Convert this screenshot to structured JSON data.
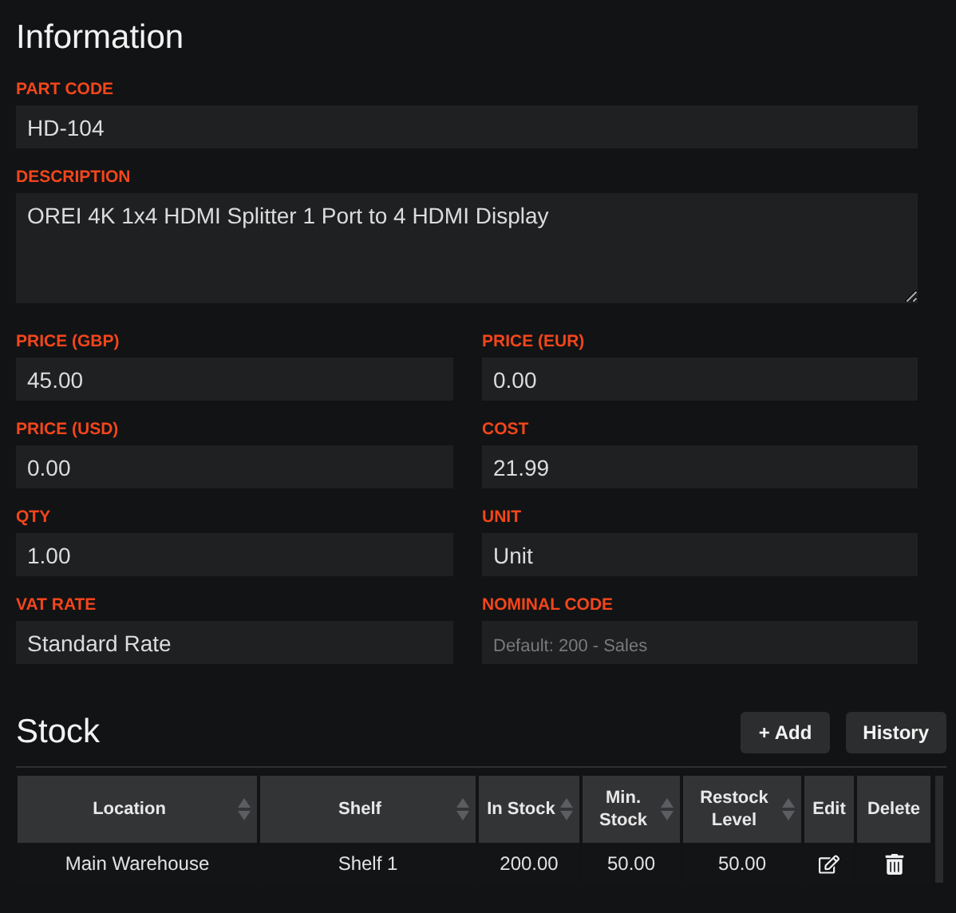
{
  "information": {
    "title": "Information",
    "part_code": {
      "label": "PART CODE",
      "value": "HD-104"
    },
    "description": {
      "label": "DESCRIPTION",
      "value": "OREI 4K 1x4 HDMI Splitter 1 Port to 4 HDMI Display"
    },
    "fields": [
      {
        "label": "PRICE (GBP)",
        "value": "45.00"
      },
      {
        "label": "PRICE (EUR)",
        "value": "0.00"
      },
      {
        "label": "PRICE (USD)",
        "value": "0.00"
      },
      {
        "label": "COST",
        "value": "21.99"
      },
      {
        "label": "QTY",
        "value": "1.00"
      },
      {
        "label": "UNIT",
        "value": "Unit"
      },
      {
        "label": "VAT RATE",
        "value": "Standard Rate"
      },
      {
        "label": "NOMINAL CODE",
        "placeholder": "Default: 200 - Sales"
      }
    ]
  },
  "stock": {
    "title": "Stock",
    "buttons": [
      "+ Add",
      "History"
    ],
    "columns": [
      {
        "label": "Location",
        "sortable": true
      },
      {
        "label": "Shelf",
        "sortable": true
      },
      {
        "label": "In Stock",
        "sortable": true
      },
      {
        "label": "Min. Stock",
        "sortable": true
      },
      {
        "label": "Restock Level",
        "sortable": true
      },
      {
        "label": "Edit",
        "sortable": false
      },
      {
        "label": "Delete",
        "sortable": false
      }
    ],
    "rows": [
      {
        "location": "Main Warehouse",
        "shelf": "Shelf 1",
        "in_stock": "200.00",
        "min_stock": "50.00",
        "restock_level": "50.00"
      }
    ]
  }
}
